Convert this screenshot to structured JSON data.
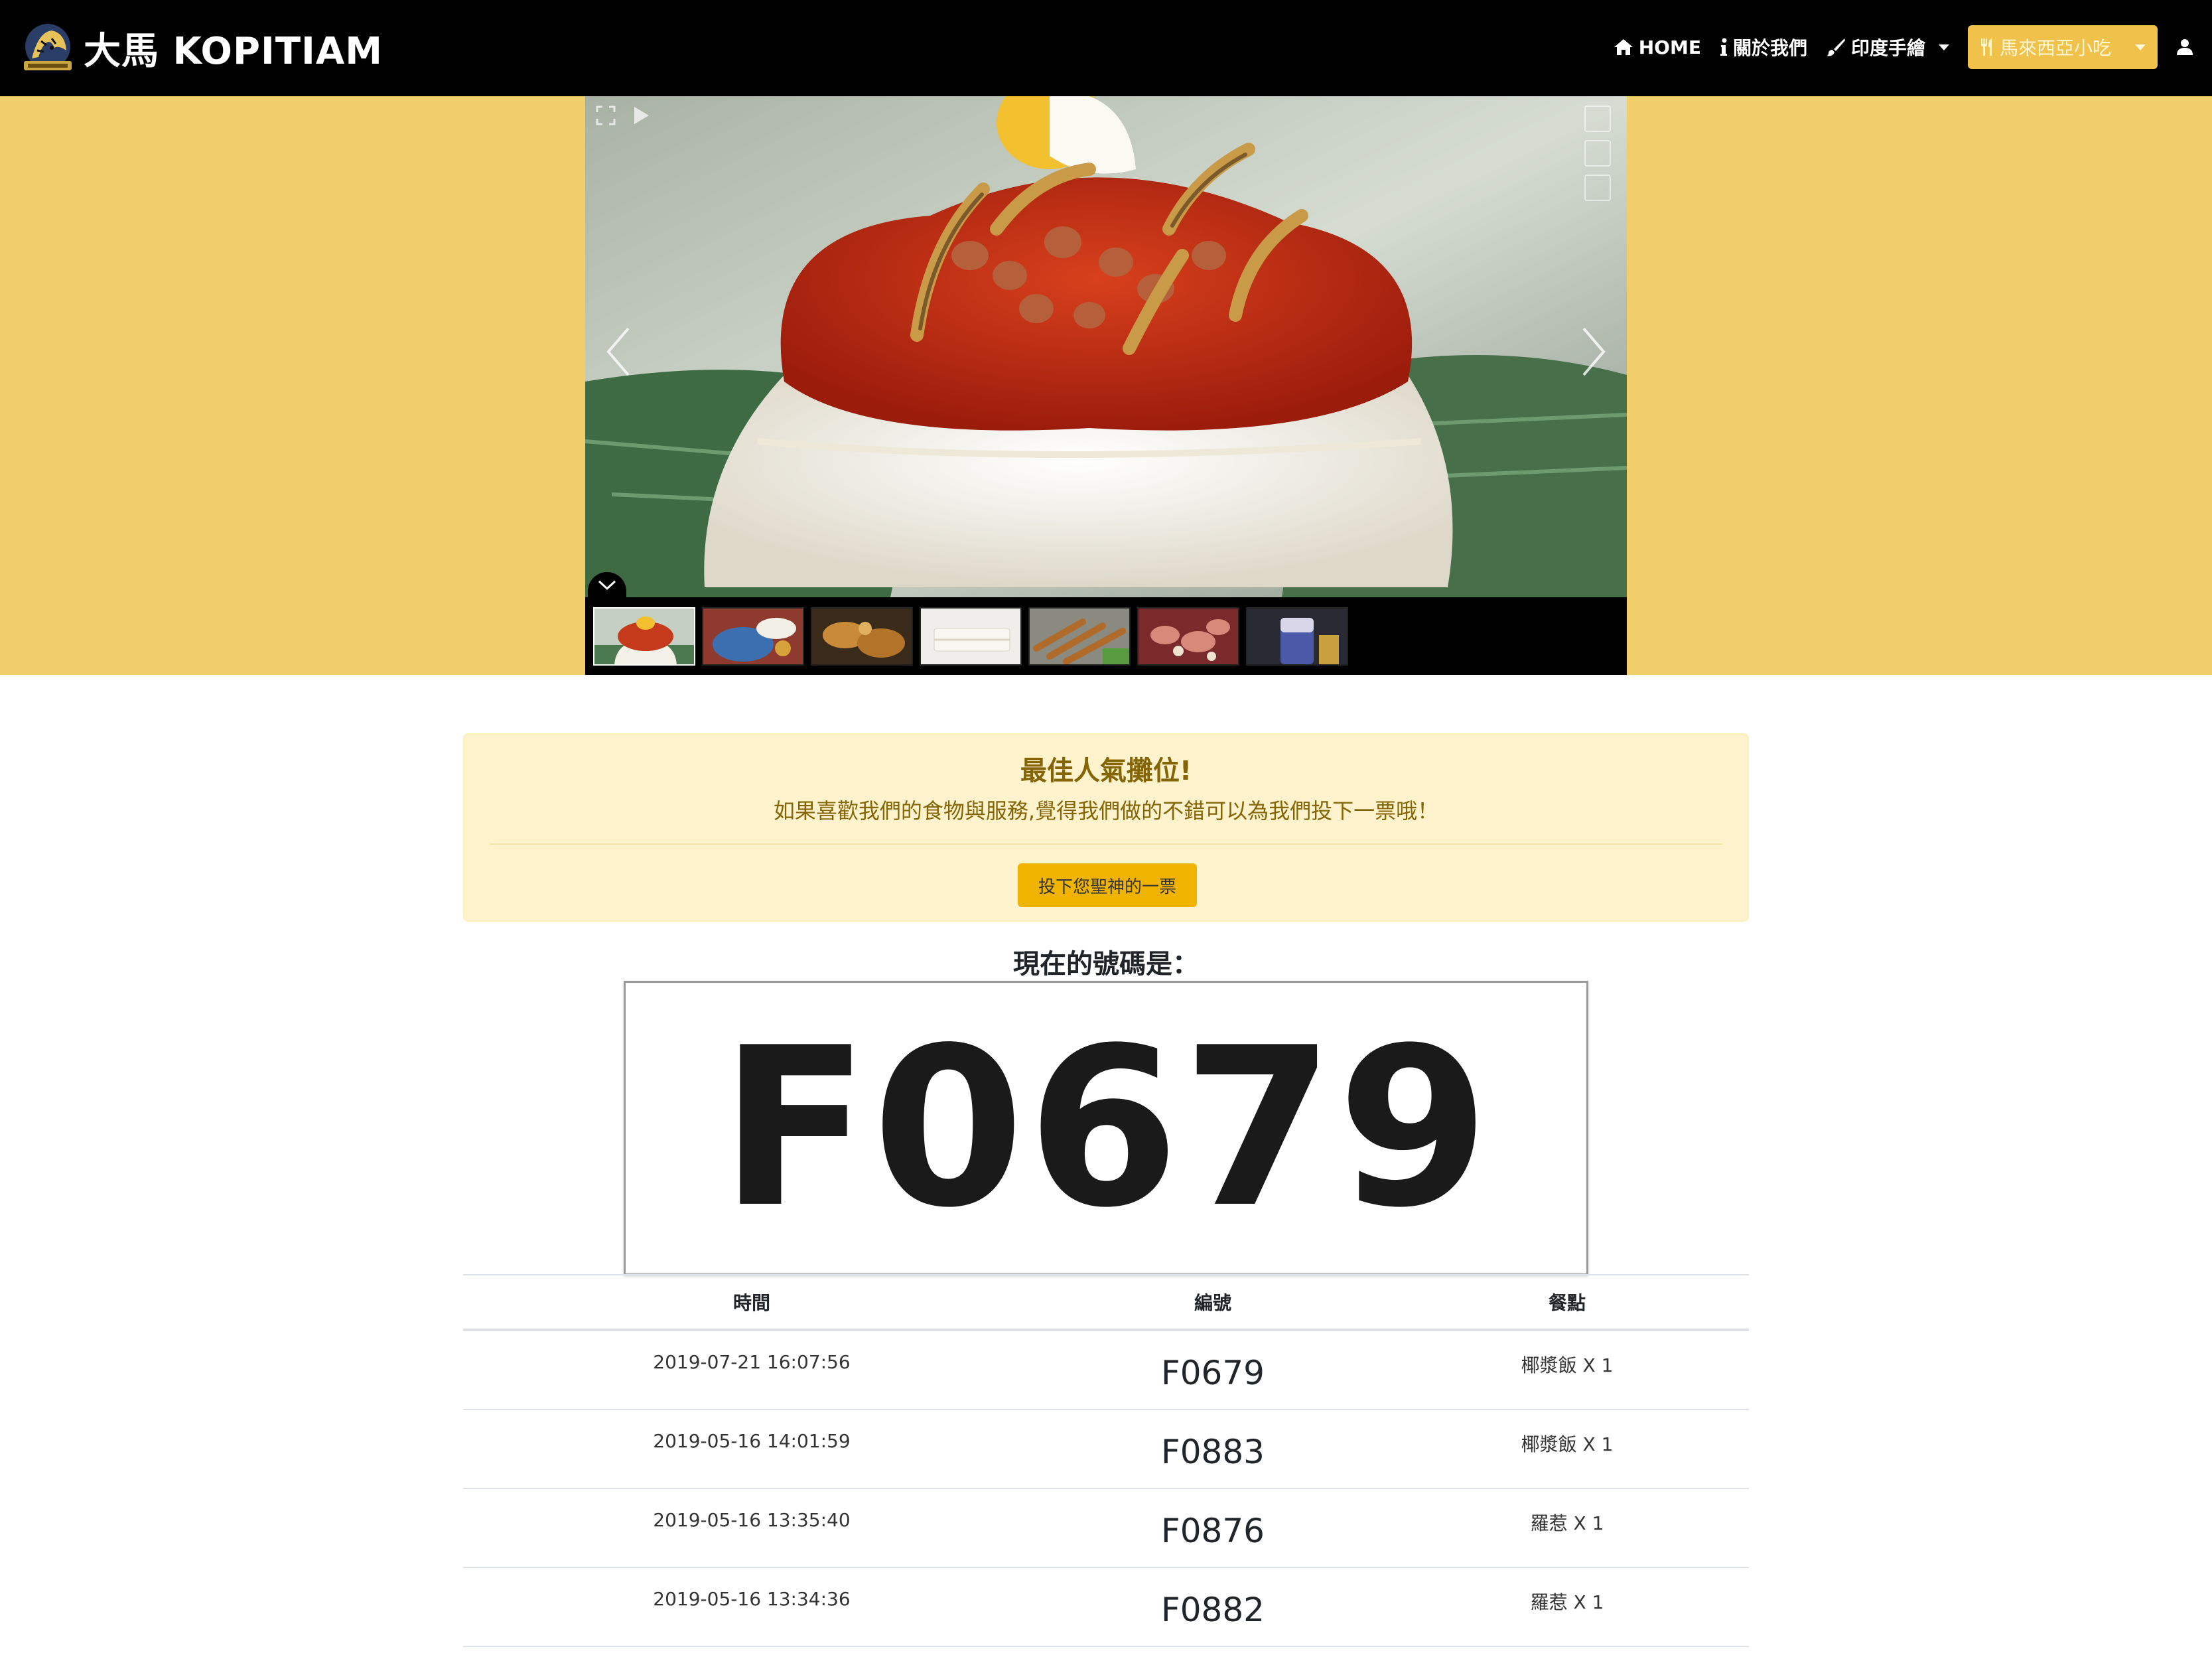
{
  "navbar": {
    "brand": "大馬 KOPITIAM",
    "items": [
      {
        "label": "HOME",
        "icon": "home-icon"
      },
      {
        "label": "關於我們",
        "icon": "info-icon"
      },
      {
        "label": "印度手繪",
        "icon": "brush-icon",
        "dropdown": true
      },
      {
        "label": "馬來西亞小吃",
        "icon": "utensils-icon",
        "dropdown": true,
        "active": true
      }
    ],
    "user_icon": "user-icon"
  },
  "gallery": {
    "thumbnail_count": 7,
    "active_index": 0
  },
  "vote": {
    "heading": "最佳人氣攤位!",
    "text": "如果喜歡我們的食物與服務,覺得我們做的不錯可以為我們投下一票哦！",
    "button": "投下您聖神的一票"
  },
  "current": {
    "label": "現在的號碼是：",
    "number": "F0679"
  },
  "table": {
    "headers": [
      "時間",
      "編號",
      "餐點"
    ],
    "rows": [
      {
        "time": "2019-07-21 16:07:56",
        "number": "F0679",
        "meal": "椰漿飯 X 1"
      },
      {
        "time": "2019-05-16 14:01:59",
        "number": "F0883",
        "meal": "椰漿飯 X 1"
      },
      {
        "time": "2019-05-16 13:35:40",
        "number": "F0876",
        "meal": "羅惹 X 1"
      },
      {
        "time": "2019-05-16 13:34:36",
        "number": "F0882",
        "meal": "羅惹 X 1"
      }
    ]
  },
  "colors": {
    "navbar_bg": "#000000",
    "hero_bg": "#f0cf6a",
    "accent": "#f0b400",
    "alert_bg": "#fff3cd",
    "alert_text": "#856404"
  }
}
